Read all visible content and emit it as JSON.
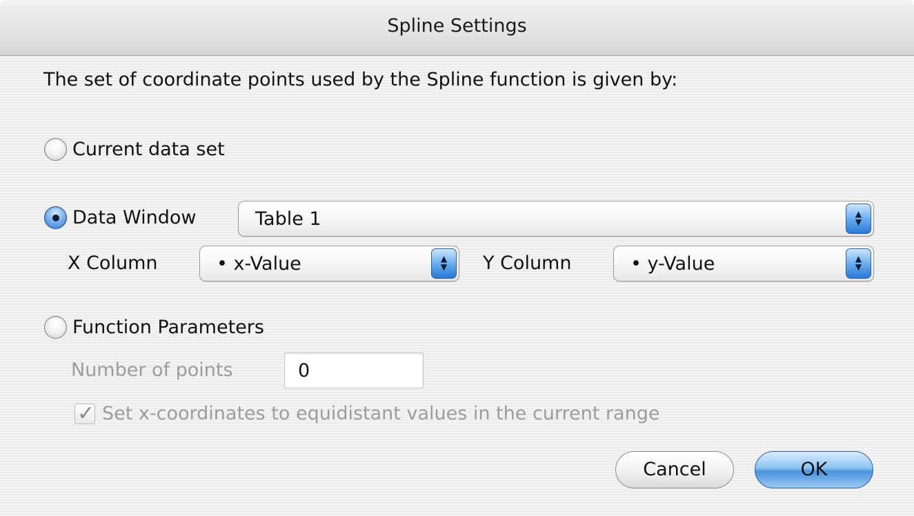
{
  "window": {
    "title": "Spline Settings"
  },
  "intro": "The set of coordinate points used by the Spline function is given by:",
  "options": {
    "current_data_set": {
      "label": "Current data set",
      "selected": false
    },
    "data_window": {
      "label": "Data Window",
      "selected": true,
      "window_select": "Table 1",
      "x_column_label": "X Column",
      "x_column_value": "• x-Value",
      "y_column_label": "Y Column",
      "y_column_value": "• y-Value"
    },
    "function_parameters": {
      "label": "Function Parameters",
      "selected": false,
      "number_of_points_label": "Number of points",
      "number_of_points_value": "0",
      "equidistant_label": "Set x-coordinates to equidistant values in the current range",
      "equidistant_checked": true
    }
  },
  "buttons": {
    "cancel": "Cancel",
    "ok": "OK"
  },
  "icons": {
    "popup_arrows": "up-down-arrows-icon",
    "checkmark": "checkmark-icon"
  },
  "colors": {
    "accent_blue": "#4a93de",
    "disabled_text": "#9c9c9c"
  }
}
